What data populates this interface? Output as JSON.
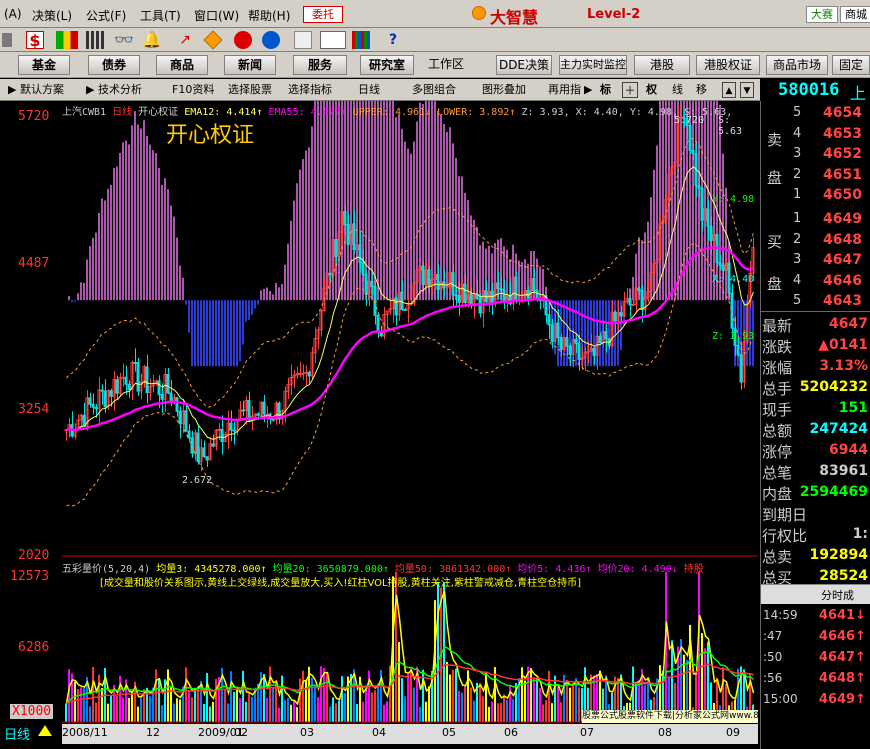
{
  "menu": {
    "items": [
      "(A)",
      "决策(L)",
      "公式(F)",
      "工具(T)",
      "窗口(W)",
      "帮助(H)"
    ],
    "trade": "委托",
    "brand": "大智慧",
    "level": "Level-2",
    "tabs": [
      "大赛",
      "商城"
    ]
  },
  "nav": {
    "buttons": [
      "基金",
      "债券",
      "商品",
      "新闻",
      "服务",
      "研究室",
      "工作区",
      "DDE决策",
      "主力实时监控",
      "港股",
      "港股权证",
      "商品市场",
      "固定"
    ]
  },
  "sub": {
    "items": [
      "默认方案",
      "技术分析",
      "F10资料",
      "选择股票",
      "选择指标",
      "日线",
      "多图组合",
      "图形叠加",
      "再用指",
      "标",
      "权",
      "线",
      "移"
    ]
  },
  "stock": {
    "code": "580016",
    "code_suffix": "上",
    "name": "上汽CWB1",
    "period": "日线",
    "indicator_line": "开心权证",
    "title_big": "开心权证"
  },
  "main_indicators": {
    "ema12": "EMA12: 4.414↑",
    "ema55": "EMA55: 4.477↑",
    "upper": "UPPER: 4.961↓",
    "lower": "LOWER: 3.892↑",
    "z": "Z: 3.93,",
    "x": "X: 4.40,",
    "y": "Y: 4.98,",
    "s": "S: 5.63,"
  },
  "annotations": {
    "high": "5.720",
    "s": "S: 5.63",
    "y": "Y: 4.98",
    "x": "X: 4.40",
    "z": "Z: 3.93",
    "low": "2.672"
  },
  "axis": {
    "price": [
      "5720",
      "4487",
      "3254",
      "2020"
    ],
    "volume": [
      "12573",
      "6286"
    ],
    "unit": "X1000"
  },
  "vol_indicators": {
    "name": "五彩量价(5,20,4)",
    "v3": "均量3: 4345278.000↑",
    "v20": "均量20: 3650879.000↑",
    "v50": "均量50: 3861342.000↑",
    "p5": "均价5: 4.436↑",
    "p20": "均价20: 4.490↓",
    "hold": "持股",
    "hint": "[成交量和股价关系图示,黄线上交绿线,成交量放大,买入!红柱VOL持股,黄柱关注,紫柱警戒减仓,青柱空仓持币]"
  },
  "dates": [
    "2008/11",
    "12",
    "2009/01",
    "02",
    "03",
    "04",
    "05",
    "06",
    "07",
    "08",
    "09"
  ],
  "bottom": {
    "period": "日线"
  },
  "orderbook": {
    "sell_label": [
      "卖",
      "盘"
    ],
    "buy_label": [
      "买",
      "盘"
    ],
    "sell": [
      {
        "level": "5",
        "price": "4654"
      },
      {
        "level": "4",
        "price": "4653"
      },
      {
        "level": "3",
        "price": "4652"
      },
      {
        "level": "2",
        "price": "4651"
      },
      {
        "level": "1",
        "price": "4650"
      }
    ],
    "buy": [
      {
        "level": "1",
        "price": "4649"
      },
      {
        "level": "2",
        "price": "4648"
      },
      {
        "level": "3",
        "price": "4647"
      },
      {
        "level": "4",
        "price": "4646"
      },
      {
        "level": "5",
        "price": "4643"
      }
    ]
  },
  "quote": [
    {
      "label": "最新",
      "value": "4647"
    },
    {
      "label": "涨跌",
      "value": "▲0141"
    },
    {
      "label": "涨幅",
      "value": "3.13%"
    },
    {
      "label": "总手",
      "value": "5204232"
    },
    {
      "label": "现手",
      "value": "151"
    },
    {
      "label": "总额",
      "value": "247424"
    },
    {
      "label": "涨停",
      "value": "6944"
    },
    {
      "label": "总笔",
      "value": "83961"
    },
    {
      "label": "内盘",
      "value": "2594469"
    },
    {
      "label": "到期日",
      "value": ""
    },
    {
      "label": "行权比",
      "value": "1:"
    },
    {
      "label": "总卖",
      "value": "192894"
    },
    {
      "label": "总买",
      "value": "28524"
    }
  ],
  "ticks": {
    "title": "分时成",
    "rows": [
      {
        "time": "14:59",
        "price": "4641↓"
      },
      {
        "time": ":47",
        "price": "4646↑"
      },
      {
        "time": ":50",
        "price": "4647↑"
      },
      {
        "time": ":56",
        "price": "4648↑"
      },
      {
        "time": "15:00",
        "price": "4649↑"
      }
    ]
  },
  "footer_ad": "股票公式股票软件下载|分析家公式网www.88gs.com"
}
